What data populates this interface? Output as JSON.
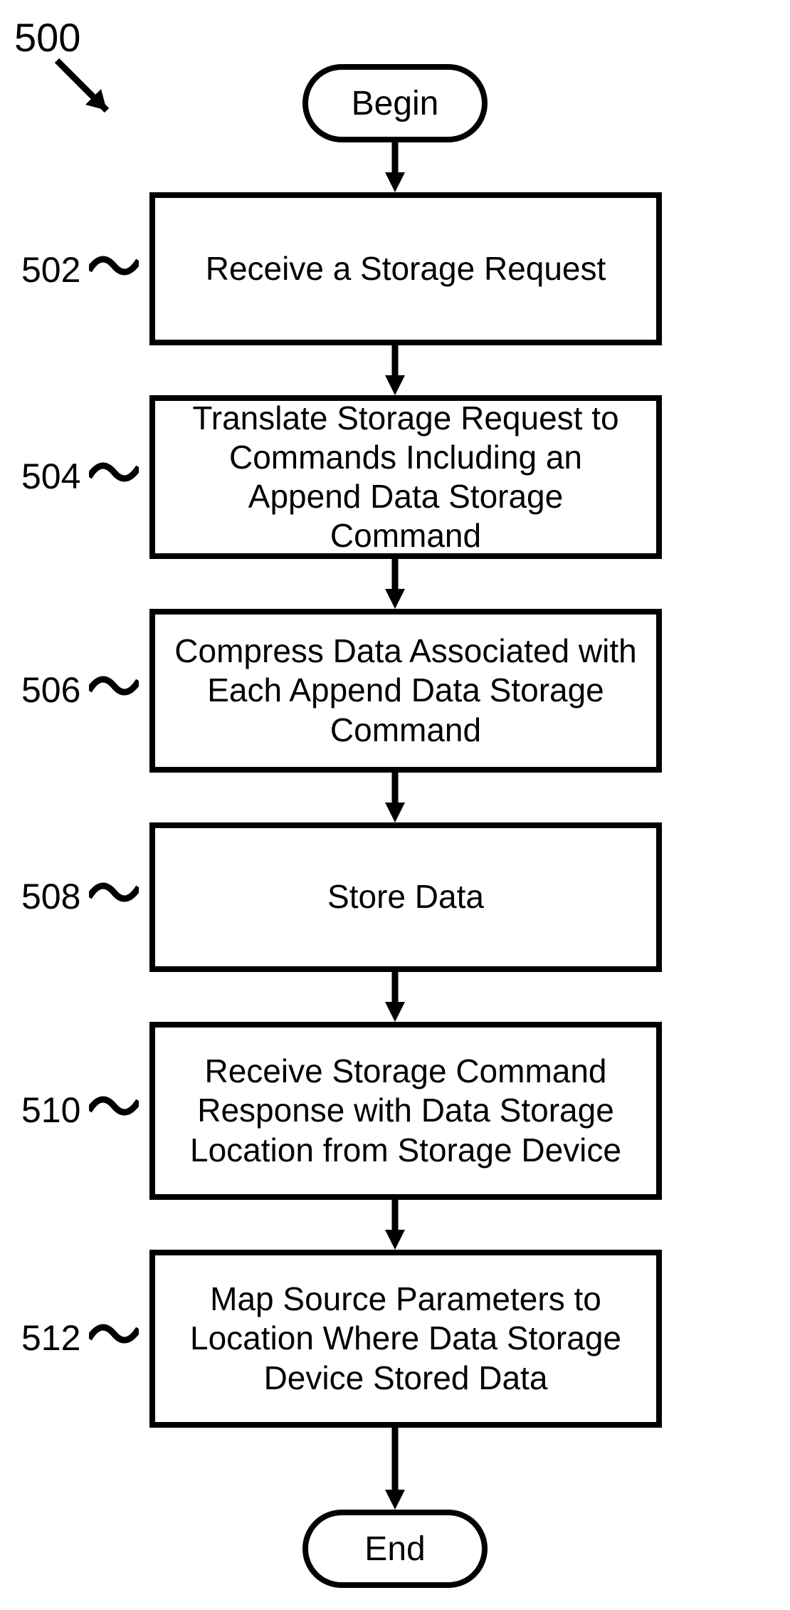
{
  "figure_label": "500",
  "terminals": {
    "begin": "Begin",
    "end": "End"
  },
  "steps": [
    {
      "num": "502",
      "text": "Receive a Storage Request"
    },
    {
      "num": "504",
      "text": "Translate Storage Request to Commands Including an Append Data Storage Command"
    },
    {
      "num": "506",
      "text": "Compress Data Associated with Each Append Data Storage Command"
    },
    {
      "num": "508",
      "text": "Store Data"
    },
    {
      "num": "510",
      "text": "Receive Storage Command Response with Data Storage Location from Storage Device"
    },
    {
      "num": "512",
      "text": "Map Source Parameters to Location Where Data Storage Device Stored Data"
    }
  ]
}
